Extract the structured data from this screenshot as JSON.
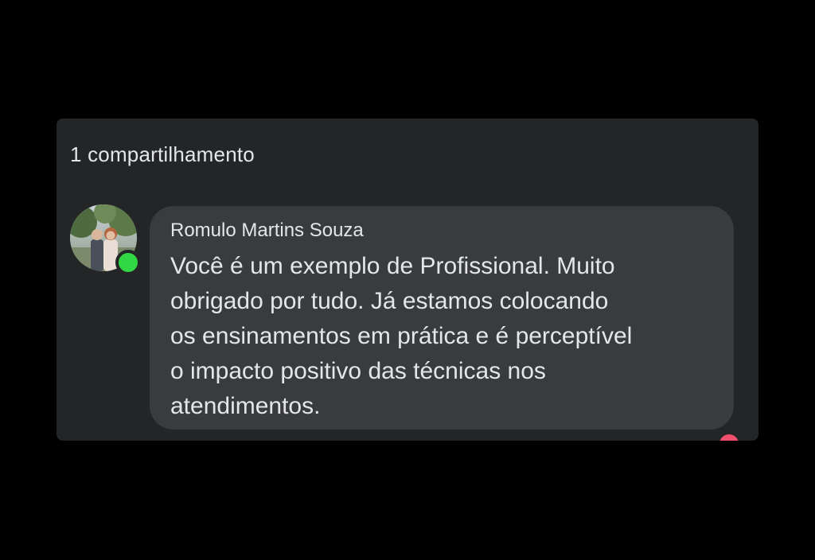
{
  "post": {
    "shares_text": "1 compartilhamento"
  },
  "comment": {
    "author": "Romulo Martins Souza",
    "text_lines": [
      "Você é um exemplo de Profissional. Muito",
      "obrigado por tudo. Já estamos colocando",
      "os ensinamentos em prática e é perceptível",
      "o impacto positivo das técnicas nos",
      "atendimentos."
    ],
    "online": true
  },
  "colors": {
    "background": "#000000",
    "card": "#242526",
    "bubble": "#3a3b3c",
    "text": "#e4e6eb",
    "online": "#31d844",
    "reaction": "#f0506e"
  }
}
